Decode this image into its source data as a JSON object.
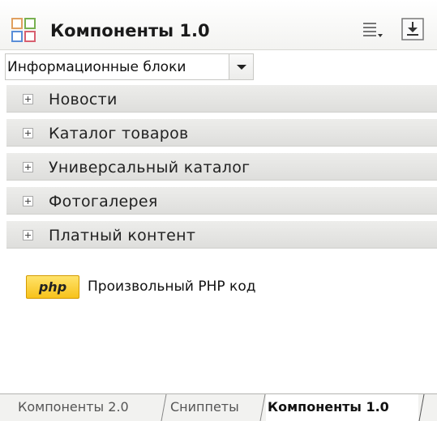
{
  "header": {
    "title": "Компоненты 1.0",
    "icon": "components-grid-icon",
    "list_icon": "list-view-icon",
    "download_icon": "download-icon"
  },
  "dropdown": {
    "value": "Информационные блоки"
  },
  "groups": [
    {
      "label": "Новости"
    },
    {
      "label": "Каталог товаров"
    },
    {
      "label": "Универсальный каталог"
    },
    {
      "label": "Фотогалерея"
    },
    {
      "label": "Платный контент"
    }
  ],
  "component_item": {
    "badge": "php",
    "label": "Произвольный PHP код"
  },
  "tabs": [
    {
      "label": "Компоненты 2.0"
    },
    {
      "label": "Сниппеты"
    },
    {
      "label": "Компоненты 1.0",
      "active": true
    }
  ],
  "colors": {
    "php_badge": "#f7c21b",
    "group_bg": "#e6e6e4"
  }
}
